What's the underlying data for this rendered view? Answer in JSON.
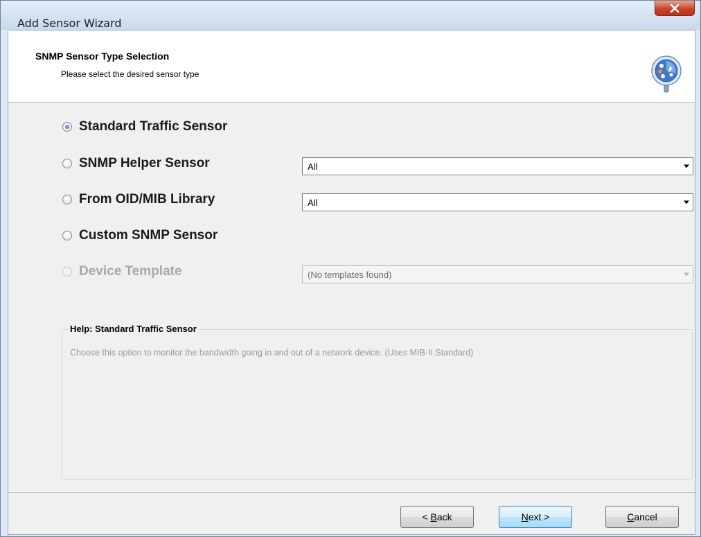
{
  "window": {
    "title": "Add Sensor Wizard",
    "close_label": "x"
  },
  "header": {
    "title": "SNMP Sensor Type Selection",
    "subtitle": "Please select the desired sensor type",
    "icon": "wizard-sensor-icon"
  },
  "options": [
    {
      "label": "Standard Traffic Sensor",
      "checked": true,
      "enabled": true
    },
    {
      "label": "SNMP Helper Sensor",
      "checked": false,
      "enabled": true,
      "select_value": "All"
    },
    {
      "label": "From OID/MIB Library",
      "checked": false,
      "enabled": true,
      "select_value": "All"
    },
    {
      "label": "Custom SNMP Sensor",
      "checked": false,
      "enabled": true
    },
    {
      "label": "Device Template",
      "checked": false,
      "enabled": false,
      "select_value": "(No templates found)"
    }
  ],
  "help": {
    "title": "Help: Standard Traffic Sensor",
    "text": "Choose this option to monitor the bandwidth going in and out of a network device. (Uses MIB-II Standard)"
  },
  "buttons": {
    "back_prefix": "< ",
    "back_mnemonic": "B",
    "back_rest": "ack",
    "next_mnemonic": "N",
    "next_rest": "ext >",
    "cancel_mnemonic": "C",
    "cancel_rest": "ancel"
  },
  "colors": {
    "titlebar": "#d6e3f2",
    "close_button": "#c9442c",
    "default_button_border": "#3c7fb1",
    "disabled_text": "#a8a8a8"
  }
}
